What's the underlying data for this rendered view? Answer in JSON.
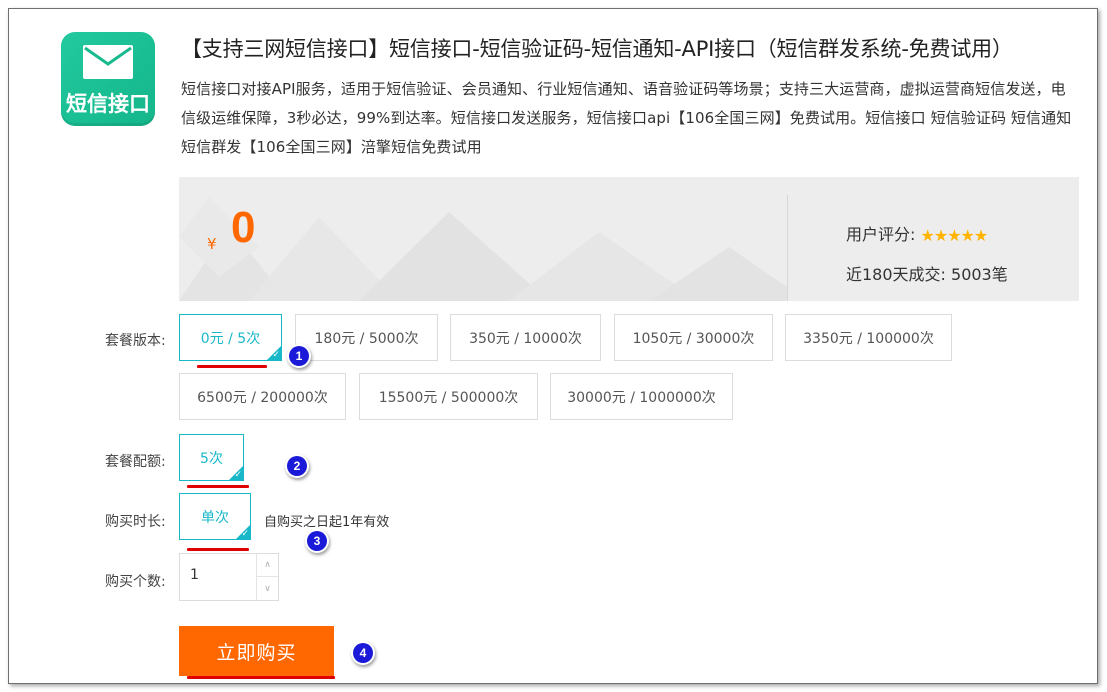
{
  "product": {
    "logo_text": "短信接口",
    "logo_icon": "envelope-icon",
    "title": "【支持三网短信接口】短信接口-短信验证码-短信通知-API接口（短信群发系统-免费试用）",
    "description": "短信接口对接API服务，适用于短信验证、会员通知、行业短信通知、语音验证码等场景；支持三大运营商，虚拟运营商短信发送，电信级运维保障，3秒必达，99%到达率。短信接口发送服务，短信接口api【106全国三网】免费试用。短信接口 短信验证码 短信通知 短信群发【106全国三网】涪擎短信免费试用"
  },
  "price": {
    "currency": "¥",
    "amount": "0",
    "rating_label": "用户评分:",
    "stars": "★★★★★",
    "rating": 5,
    "sales_text": "近180天成交: 5003笔"
  },
  "package_version": {
    "label": "套餐版本:",
    "options": [
      "0元 / 5次",
      "180元 / 5000次",
      "350元 / 10000次",
      "1050元 / 30000次",
      "3350元 / 100000次",
      "6500元 / 200000次",
      "15500元  / 500000次",
      "30000元 / 1000000次"
    ],
    "selected_index": 0
  },
  "package_quota": {
    "label": "套餐配额:",
    "options": [
      "5次"
    ],
    "selected_index": 0
  },
  "duration": {
    "label": "购买时长:",
    "options": [
      "单次"
    ],
    "selected_index": 0,
    "note": "自购买之日起1年有效"
  },
  "quantity": {
    "label": "购买个数:",
    "value": "1"
  },
  "buy_button": "立即购买",
  "annotations": [
    "1",
    "2",
    "3",
    "4"
  ],
  "colors": {
    "accent_orange": "#ff6700",
    "selected_teal": "#19b8c9",
    "annotation_blue": "#1a1ad8",
    "underline_red": "#e00000",
    "logo_green": "#1bbf95"
  }
}
